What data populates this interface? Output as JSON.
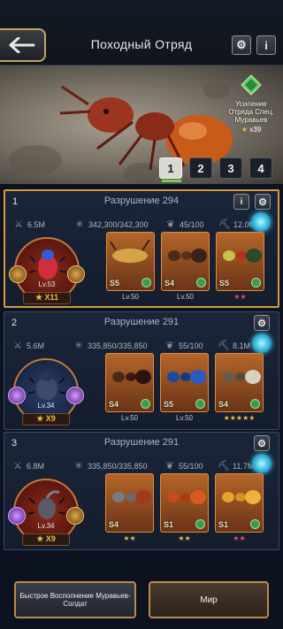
{
  "header": {
    "title": "Походный Отряд",
    "back_icon": "back-arrow-icon",
    "settings_icon": "gear-icon",
    "info_label": "i"
  },
  "hero": {
    "buff_text": "Усиление Отряда Спец. Муравьев",
    "buff_count": "x39"
  },
  "tabs": [
    "1",
    "2",
    "3",
    "4"
  ],
  "active_tab": 0,
  "squads": [
    {
      "number": "1",
      "destruction": "Разрушение 294",
      "info_label": "i",
      "stats": {
        "power": "6.5M",
        "troops": "342,300/342,300",
        "marches": "45/100",
        "load": "12.0M"
      },
      "leader": {
        "level": "Lv.53",
        "stars": "★ X11"
      },
      "units": [
        {
          "rank": "S5",
          "sub": "Lv.50"
        },
        {
          "rank": "S4",
          "sub": "Lv.50"
        },
        {
          "rank": "S5",
          "sub": "★★"
        }
      ]
    },
    {
      "number": "2",
      "destruction": "Разрушение 291",
      "stats": {
        "power": "5.6M",
        "troops": "335,850/335,850",
        "marches": "55/100",
        "load": "8.1M"
      },
      "leader": {
        "level": "Lv.34",
        "stars": "★ X9"
      },
      "units": [
        {
          "rank": "S4",
          "sub": "Lv.50"
        },
        {
          "rank": "S5",
          "sub": "Lv.50"
        },
        {
          "rank": "S4",
          "sub": "★★★★★"
        }
      ]
    },
    {
      "number": "3",
      "destruction": "Разрушение 291",
      "stats": {
        "power": "6.8M",
        "troops": "335,850/335,850",
        "marches": "55/100",
        "load": "11.7M"
      },
      "leader": {
        "level": "Lv.34",
        "stars": "★ X9"
      },
      "units": [
        {
          "rank": "S4",
          "sub": "★★"
        },
        {
          "rank": "S1",
          "sub": "★★"
        },
        {
          "rank": "S1",
          "sub": "★★"
        }
      ]
    }
  ],
  "buttons": {
    "quick_refill": "Быстрое Восполнение Муравьев-Солдат",
    "world": "Мир"
  },
  "colors": {
    "accent_gold": "#d59a3e",
    "panel": "#1a2539",
    "card": "#b4662a"
  }
}
